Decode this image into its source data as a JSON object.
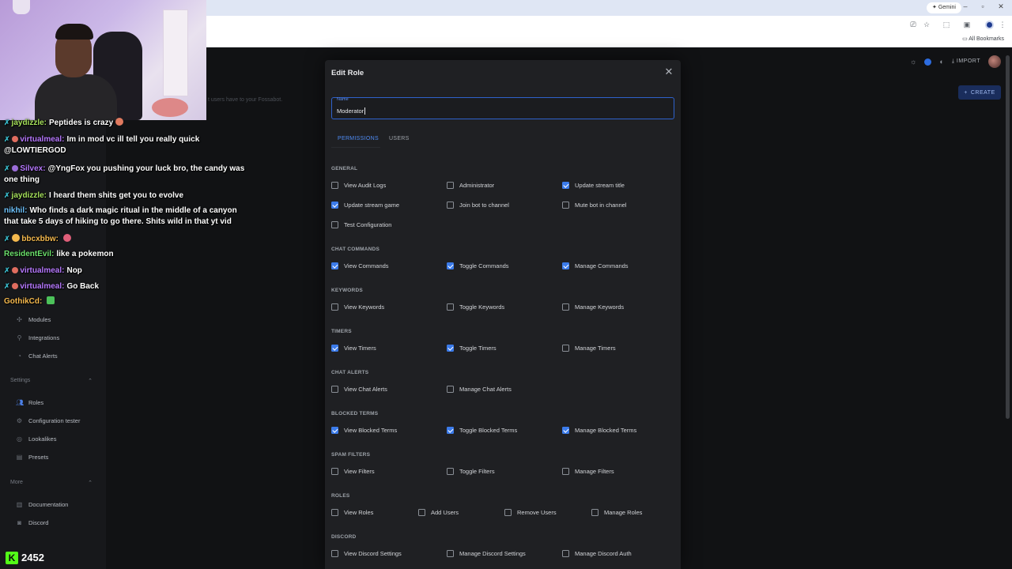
{
  "browser": {
    "gemini_label": "Gemini",
    "bookmarks_label": "All Bookmarks"
  },
  "appbar": {
    "import_label": "IMPORT",
    "create_label": "CREATE",
    "description": "t users have to your Fossabot."
  },
  "sidebar": {
    "items": [
      {
        "label": "Modules",
        "icon": "modules-icon"
      },
      {
        "label": "Integrations",
        "icon": "integrations-icon"
      },
      {
        "label": "Chat Alerts",
        "icon": "chat-alerts-icon"
      }
    ],
    "settings_label": "Settings",
    "settings_items": [
      {
        "label": "Roles",
        "icon": "roles-icon"
      },
      {
        "label": "Configuration tester",
        "icon": "gear-icon"
      },
      {
        "label": "Lookalikes",
        "icon": "lookalikes-icon"
      },
      {
        "label": "Presets",
        "icon": "presets-icon"
      }
    ],
    "more_label": "More",
    "more_items": [
      {
        "label": "Documentation",
        "icon": "book-icon"
      },
      {
        "label": "Discord",
        "icon": "discord-icon"
      }
    ]
  },
  "chat": {
    "messages": [
      {
        "user": "jaydizzle:",
        "text": "Peptides is crazy",
        "color": "#a5e05b"
      },
      {
        "user": "virtualmeal:",
        "text": "Im in mod vc ill tell you really quick @LOWTIERGOD",
        "color": "#b779ff"
      },
      {
        "user": "Silvex:",
        "text": "@YngFox you pushing your luck bro, the candy was one thing",
        "color": "#b779ff"
      },
      {
        "user": "jaydizzle:",
        "text": "I heard them shits get you to evolve",
        "color": "#a5e05b"
      },
      {
        "user": "nikhil:",
        "text": "Who finds a dark magic ritual in the middle of a canyon that take 5 days of hiking to go there. Shits wild in that yt vid",
        "color": "#6fc4ff"
      },
      {
        "user": "bbcxbbw:",
        "text": "",
        "color": "#f5b94e"
      },
      {
        "user": "ResidentEvil:",
        "text": "like a pokemon",
        "color": "#6be06b"
      },
      {
        "user": "virtualmeal:",
        "text": "Nop",
        "color": "#b779ff"
      },
      {
        "user": "virtualmeal:",
        "text": "Go Back",
        "color": "#b779ff"
      },
      {
        "user": "GothikCd:",
        "text": "",
        "color": "#f5b94e"
      }
    ],
    "viewer_count": "2452"
  },
  "modal": {
    "title": "Edit Role",
    "name_label": "Name",
    "name_value": "Moderator",
    "tabs": [
      "PERMISSIONS",
      "USERS"
    ],
    "sections": [
      {
        "title": "GENERAL",
        "perms": [
          {
            "label": "View Audit Logs",
            "checked": false
          },
          {
            "label": "Administrator",
            "checked": false
          },
          {
            "label": "Update stream title",
            "checked": true
          },
          {
            "label": "Update stream game",
            "checked": true
          },
          {
            "label": "Join bot to channel",
            "checked": false
          },
          {
            "label": "Mute bot in channel",
            "checked": false
          },
          {
            "label": "Test Configuration",
            "checked": false
          }
        ]
      },
      {
        "title": "CHAT COMMANDS",
        "perms": [
          {
            "label": "View Commands",
            "checked": true
          },
          {
            "label": "Toggle Commands",
            "checked": true
          },
          {
            "label": "Manage Commands",
            "checked": true
          }
        ]
      },
      {
        "title": "KEYWORDS",
        "perms": [
          {
            "label": "View Keywords",
            "checked": false
          },
          {
            "label": "Toggle Keywords",
            "checked": false
          },
          {
            "label": "Manage Keywords",
            "checked": false
          }
        ]
      },
      {
        "title": "TIMERS",
        "perms": [
          {
            "label": "View Timers",
            "checked": true
          },
          {
            "label": "Toggle Timers",
            "checked": true
          },
          {
            "label": "Manage Timers",
            "checked": false
          }
        ]
      },
      {
        "title": "CHAT ALERTS",
        "perms": [
          {
            "label": "View Chat Alerts",
            "checked": false
          },
          {
            "label": "Manage Chat Alerts",
            "checked": false
          }
        ]
      },
      {
        "title": "BLOCKED TERMS",
        "perms": [
          {
            "label": "View Blocked Terms",
            "checked": true
          },
          {
            "label": "Toggle Blocked Terms",
            "checked": true
          },
          {
            "label": "Manage Blocked Terms",
            "checked": true
          }
        ]
      },
      {
        "title": "SPAM FILTERS",
        "perms": [
          {
            "label": "View Filters",
            "checked": false
          },
          {
            "label": "Toggle Filters",
            "checked": false
          },
          {
            "label": "Manage Filters",
            "checked": false
          }
        ]
      },
      {
        "title": "ROLES",
        "perms": [
          {
            "label": "View Roles",
            "checked": false
          },
          {
            "label": "Add Users",
            "checked": false
          },
          {
            "label": "Remove Users",
            "checked": false
          },
          {
            "label": "Manage Roles",
            "checked": false
          }
        ]
      },
      {
        "title": "DISCORD",
        "perms": [
          {
            "label": "View Discord Settings",
            "checked": false
          },
          {
            "label": "Manage Discord Settings",
            "checked": false
          },
          {
            "label": "Manage Discord Auth",
            "checked": false
          }
        ]
      }
    ]
  },
  "colors": {
    "accent": "#3b7bea",
    "modal_bg": "#1f2023",
    "page_bg": "#111214",
    "kick_green": "#53fc18"
  }
}
